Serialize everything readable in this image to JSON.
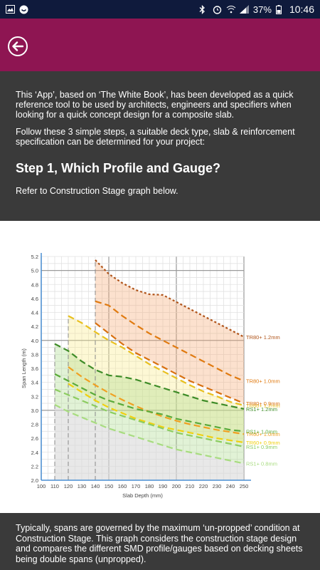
{
  "status": {
    "battery": "37%",
    "time": "10:46"
  },
  "intro": {
    "p1": "This ‘App’, based on ‘The White Book’, has been developed as a quick reference tool to be used by architects, engineers and specifiers when looking for a quick concept design for a composite slab.",
    "p2": "Follow these 3 simple steps, a suitable deck type, slab & reinforcement specification can be determined for your project:",
    "step_title": "Step 1, Which Profile and Gauge?",
    "step_sub": "Refer to Construction Stage graph below."
  },
  "footer": {
    "text": "Typically, spans are governed by the maximum ‘un-propped’ condition at Construction Stage.  This graph considers the construction stage design and compares the different SMD profile/gauges based on decking sheets being double spans (unpropped)."
  },
  "chart_data": {
    "type": "line",
    "xlabel": "Slab Depth (mm)",
    "ylabel": "Span Length (m)",
    "xlim": [
      100,
      250
    ],
    "ylim": [
      2.0,
      5.2
    ],
    "x_ticks": [
      100,
      110,
      120,
      130,
      140,
      150,
      160,
      170,
      180,
      190,
      200,
      210,
      220,
      230,
      240,
      250
    ],
    "y_ticks": [
      2.0,
      2.2,
      2.4,
      2.6,
      2.8,
      3.0,
      3.2,
      3.4,
      3.6,
      3.8,
      4.0,
      4.2,
      4.4,
      4.6,
      4.8,
      5.0,
      5.2
    ],
    "series": [
      {
        "name": "TR80+ 1.2mm",
        "color": "#b0541a",
        "x": [
          140,
          150,
          160,
          170,
          180,
          190,
          200,
          210,
          220,
          230,
          240,
          250
        ],
        "y": [
          5.15,
          4.95,
          4.82,
          4.72,
          4.66,
          4.65,
          4.55,
          4.45,
          4.35,
          4.25,
          4.15,
          4.05
        ]
      },
      {
        "name": "TR80+ 1.0mm",
        "color": "#e07a10",
        "x": [
          140,
          150,
          160,
          170,
          180,
          190,
          200,
          210,
          220,
          230,
          240,
          250
        ],
        "y": [
          4.56,
          4.5,
          4.35,
          4.22,
          4.1,
          4.0,
          3.9,
          3.8,
          3.7,
          3.6,
          3.5,
          3.42
        ]
      },
      {
        "name": "TR60+ 1.2mm",
        "color": "#e8c020",
        "x": [
          120,
          130,
          140,
          150,
          160,
          170,
          180,
          190,
          200,
          210,
          220,
          230,
          240,
          250
        ],
        "y": [
          4.35,
          4.25,
          4.12,
          4.0,
          3.9,
          3.78,
          3.66,
          3.56,
          3.46,
          3.36,
          3.27,
          3.2,
          3.12,
          3.07
        ]
      },
      {
        "name": "TR80+ 0.9mm",
        "color": "#d87010",
        "x": [
          140,
          150,
          160,
          170,
          180,
          190,
          200,
          210,
          220,
          230,
          240,
          250
        ],
        "y": [
          4.25,
          4.1,
          3.95,
          3.82,
          3.72,
          3.62,
          3.52,
          3.42,
          3.34,
          3.26,
          3.18,
          3.1
        ]
      },
      {
        "name": "RS1+ 1.2mm",
        "color": "#3e8c28",
        "x": [
          110,
          120,
          130,
          140,
          150,
          160,
          170,
          180,
          190,
          200,
          210,
          220,
          230,
          240,
          250
        ],
        "y": [
          3.95,
          3.85,
          3.7,
          3.58,
          3.5,
          3.48,
          3.44,
          3.38,
          3.32,
          3.26,
          3.2,
          3.14,
          3.1,
          3.06,
          3.02
        ]
      },
      {
        "name": "TR60+ 1.0mm",
        "color": "#f0a020",
        "x": [
          120,
          130,
          140,
          150,
          160,
          170,
          180,
          190,
          200,
          210,
          220,
          230,
          240,
          250
        ],
        "y": [
          3.62,
          3.48,
          3.36,
          3.25,
          3.15,
          3.06,
          2.98,
          2.91,
          2.85,
          2.8,
          2.76,
          2.72,
          2.69,
          2.66
        ]
      },
      {
        "name": "RS1+ 1.0mm",
        "color": "#5aaa3a",
        "x": [
          110,
          120,
          130,
          140,
          150,
          160,
          170,
          180,
          190,
          200,
          210,
          220,
          230,
          240,
          250
        ],
        "y": [
          3.52,
          3.42,
          3.32,
          3.22,
          3.14,
          3.08,
          3.02,
          2.98,
          2.94,
          2.88,
          2.84,
          2.8,
          2.76,
          2.72,
          2.7
        ]
      },
      {
        "name": "TR60+ 0.9mm",
        "color": "#f0d010",
        "x": [
          120,
          130,
          140,
          150,
          160,
          170,
          180,
          190,
          200,
          210,
          220,
          230,
          240,
          250
        ],
        "y": [
          3.38,
          3.26,
          3.14,
          3.04,
          2.96,
          2.88,
          2.82,
          2.76,
          2.72,
          2.68,
          2.64,
          2.6,
          2.57,
          2.54
        ]
      },
      {
        "name": "RS1+ 0.9mm",
        "color": "#8ccc60",
        "x": [
          110,
          120,
          130,
          140,
          150,
          160,
          170,
          180,
          190,
          200,
          210,
          220,
          230,
          240,
          250
        ],
        "y": [
          3.3,
          3.22,
          3.14,
          3.06,
          2.98,
          2.92,
          2.86,
          2.8,
          2.74,
          2.68,
          2.64,
          2.6,
          2.56,
          2.52,
          2.48
        ]
      },
      {
        "name": "RS1+ 0.8mm",
        "color": "#a8dc80",
        "x": [
          110,
          120,
          130,
          140,
          150,
          160,
          170,
          180,
          190,
          200,
          210,
          220,
          230,
          240,
          250
        ],
        "y": [
          3.08,
          2.98,
          2.9,
          2.82,
          2.74,
          2.68,
          2.62,
          2.56,
          2.5,
          2.44,
          2.4,
          2.36,
          2.32,
          2.28,
          2.24
        ]
      }
    ],
    "legend": "right"
  }
}
